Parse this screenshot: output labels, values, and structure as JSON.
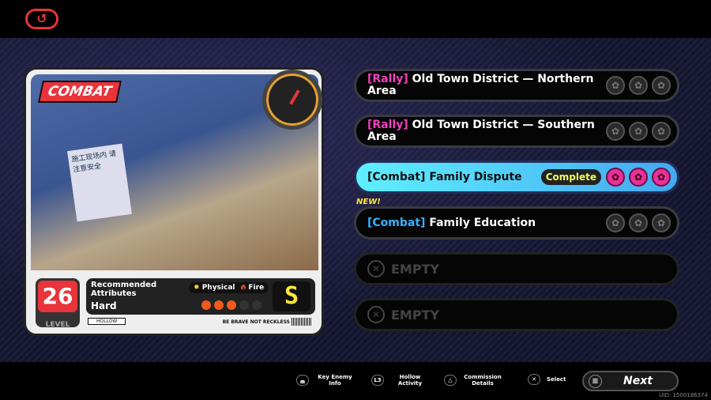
{
  "header": {
    "back_icon": "back-arrow-icon",
    "back_glyph": "↺"
  },
  "card": {
    "tag": "COMBAT",
    "sign_text": "施工现场内 请注意安全",
    "level": "26",
    "level_label": "LEVEL",
    "recommended": "Recommended Attributes",
    "difficulty": "Hard",
    "attributes": [
      "Physical",
      "Fire"
    ],
    "difficulty_dots": 3,
    "difficulty_max": 5,
    "rank": "S",
    "hollow": "HOLLOW",
    "brave": "BE BRAVE NOT RECKLESS"
  },
  "commissions": [
    {
      "tag": "[Rally]",
      "title": "Old Town District — Northern Area",
      "tag_color": "#f040c0",
      "state": "normal"
    },
    {
      "tag": "[Rally]",
      "title": "Old Town District — Southern Area",
      "tag_color": "#f040c0",
      "state": "normal"
    },
    {
      "tag": "[Combat]",
      "title": "Family Dispute",
      "state": "selected",
      "badge": "Complete"
    },
    {
      "tag": "[Combat]",
      "title": "Family Education",
      "tag_color": "#39b0ff",
      "state": "normal",
      "new": "NEW!"
    },
    {
      "title": "EMPTY",
      "state": "empty"
    },
    {
      "title": "EMPTY",
      "state": "empty"
    }
  ],
  "footer": {
    "hints": [
      {
        "key": "◛",
        "label": "Key Enemy Info"
      },
      {
        "key": "L3",
        "label": "Hollow Activity"
      },
      {
        "key": "△",
        "label": "Commission Details"
      },
      {
        "key": "✕",
        "label": "Select"
      }
    ],
    "next": "Next",
    "uid": "UID: 1500186374"
  }
}
